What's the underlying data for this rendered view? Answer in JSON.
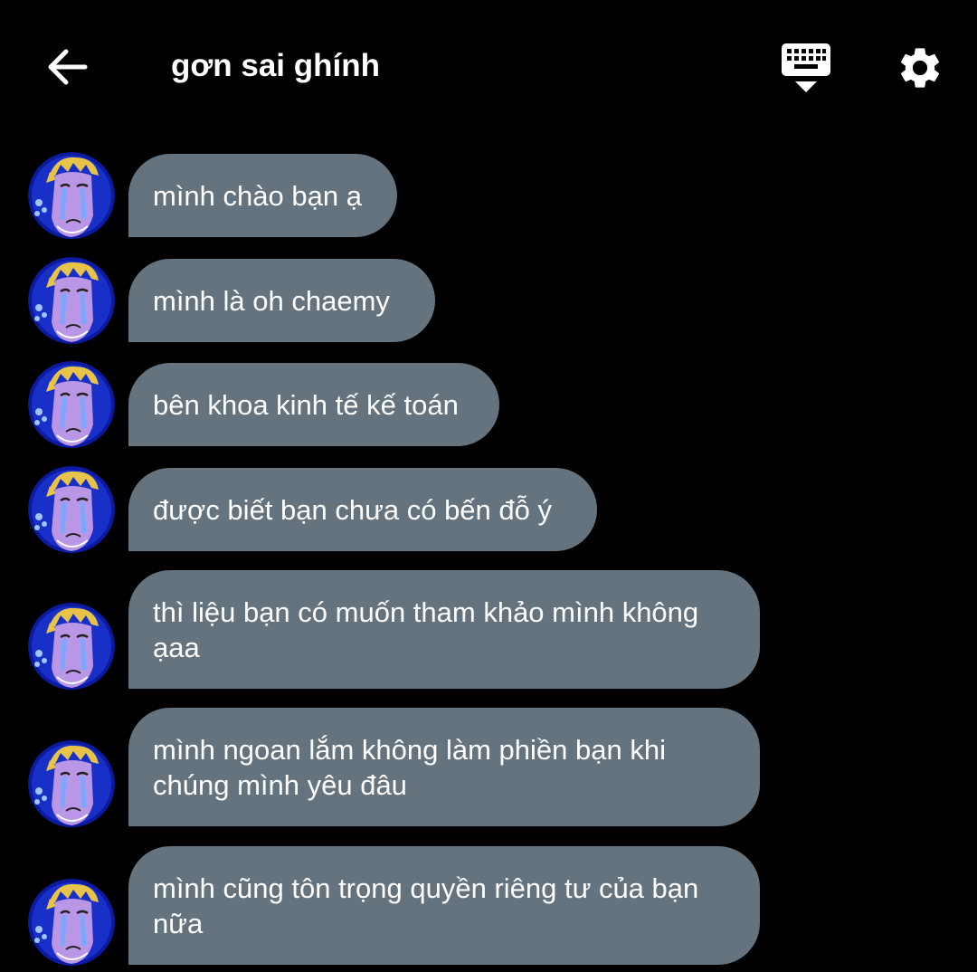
{
  "header": {
    "title": "gơn sai ghính",
    "back_icon": "arrow-left-icon",
    "keyboard_icon": "keyboard-hide-icon",
    "settings_icon": "gear-icon"
  },
  "colors": {
    "background": "#000000",
    "bubble": "#65737e",
    "text": "#ffffff"
  },
  "messages": [
    {
      "text": "mình chào bạn ạ"
    },
    {
      "text": "mình là oh chaemy"
    },
    {
      "text": "bên khoa kinh tế kế toán"
    },
    {
      "text": "được biết bạn chưa có bến đỗ ý"
    },
    {
      "text": "thì liệu bạn có muốn tham khảo mình không ạaa"
    },
    {
      "text": "mình ngoan lắm không làm phiền bạn khi chúng mình yêu đâu"
    },
    {
      "text": "mình cũng tôn trọng quyền riêng tư của bạn nữa"
    }
  ]
}
